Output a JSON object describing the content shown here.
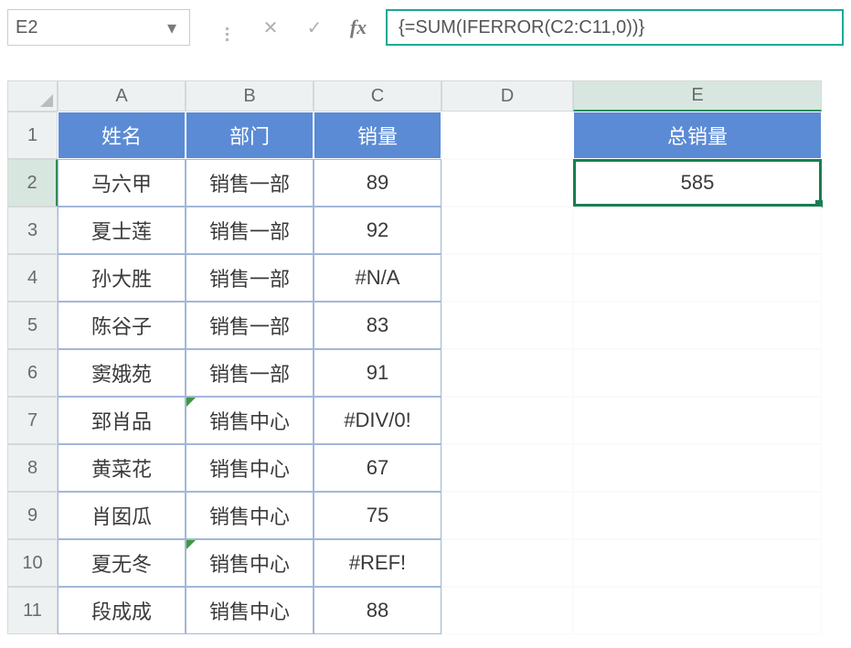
{
  "name_box": {
    "value": "E2"
  },
  "formula_bar": {
    "formula": "{=SUM(IFERROR(C2:C11,0))}"
  },
  "columns": [
    "A",
    "B",
    "C",
    "D",
    "E"
  ],
  "rows": [
    "1",
    "2",
    "3",
    "4",
    "5",
    "6",
    "7",
    "8",
    "9",
    "10",
    "11"
  ],
  "selected_col": "E",
  "selected_row": "2",
  "headers": {
    "A": "姓名",
    "B": "部门",
    "C": "销量",
    "E": "总销量"
  },
  "data": [
    {
      "name": "马六甲",
      "dept": "销售一部",
      "sales": "89"
    },
    {
      "name": "夏士莲",
      "dept": "销售一部",
      "sales": "92"
    },
    {
      "name": "孙大胜",
      "dept": "销售一部",
      "sales": "#N/A"
    },
    {
      "name": "陈谷子",
      "dept": "销售一部",
      "sales": "83"
    },
    {
      "name": "窦娥苑",
      "dept": "销售一部",
      "sales": "91"
    },
    {
      "name": "郅肖品",
      "dept": "销售中心",
      "sales": "#DIV/0!",
      "flag_dept": true
    },
    {
      "name": "黄菜花",
      "dept": "销售中心",
      "sales": "67"
    },
    {
      "name": "肖囡瓜",
      "dept": "销售中心",
      "sales": "75"
    },
    {
      "name": "夏无冬",
      "dept": "销售中心",
      "sales": "#REF!",
      "flag_dept": true
    },
    {
      "name": "段成成",
      "dept": "销售中心",
      "sales": "88"
    }
  ],
  "total": {
    "value": "585"
  },
  "icons": {
    "dropdown": "▾",
    "cancel": "✕",
    "enter": "✓",
    "fx": "fx",
    "grip": "⋮"
  }
}
